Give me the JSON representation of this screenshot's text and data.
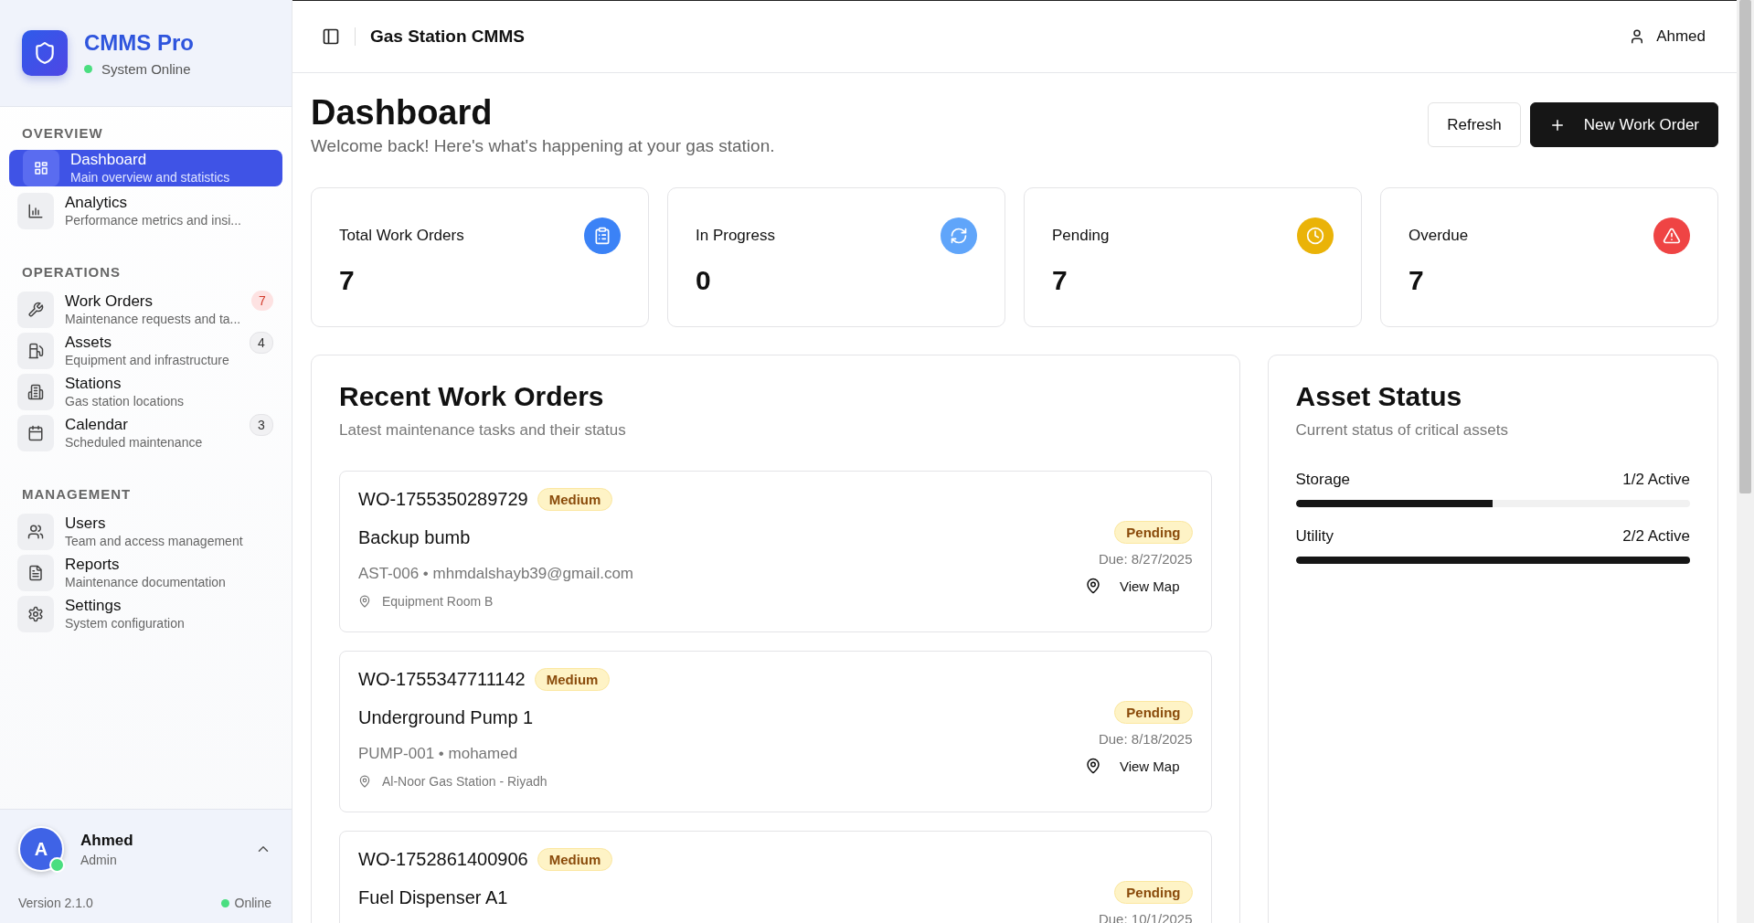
{
  "sidebar": {
    "brand": {
      "name": "CMMS Pro",
      "status": "System Online",
      "online": true
    },
    "sections": [
      {
        "label": "OVERVIEW",
        "items": [
          {
            "kind": "dashboard",
            "title": "Dashboard",
            "subtitle": "Main overview and statistics",
            "selected": true
          },
          {
            "kind": "analytics",
            "title": "Analytics",
            "subtitle": "Performance metrics and insi...",
            "selected": false
          }
        ]
      },
      {
        "label": "OPERATIONS",
        "items": [
          {
            "kind": "work-orders",
            "title": "Work Orders",
            "subtitle": "Maintenance requests and ta...",
            "selected": false,
            "badge": {
              "text": "7",
              "alert": true
            }
          },
          {
            "kind": "assets",
            "title": "Assets",
            "subtitle": "Equipment and infrastructure",
            "selected": false,
            "badge": {
              "text": "4",
              "alert": false
            }
          },
          {
            "kind": "stations",
            "title": "Stations",
            "subtitle": "Gas station locations",
            "selected": false
          },
          {
            "kind": "calendar",
            "title": "Calendar",
            "subtitle": "Scheduled maintenance",
            "selected": false,
            "badge": {
              "text": "3",
              "alert": false
            }
          }
        ]
      },
      {
        "label": "MANAGEMENT",
        "items": [
          {
            "kind": "users",
            "title": "Users",
            "subtitle": "Team and access management",
            "selected": false
          },
          {
            "kind": "reports",
            "title": "Reports",
            "subtitle": "Maintenance documentation",
            "selected": false
          },
          {
            "kind": "settings",
            "title": "Settings",
            "subtitle": "System configuration",
            "selected": false
          }
        ]
      }
    ],
    "user": {
      "initial": "A",
      "name": "Ahmed",
      "role": "Admin",
      "online": true
    },
    "footer": {
      "version": "Version 2.1.0",
      "status": "Online"
    }
  },
  "header": {
    "title": "Gas Station CMMS",
    "user": "Ahmed"
  },
  "page": {
    "title": "Dashboard",
    "subtitle": "Welcome back! Here's what's happening at your gas station.",
    "buttons": [
      {
        "kind": "secondary",
        "label": "Refresh"
      },
      {
        "kind": "primary",
        "label": "New Work Order"
      }
    ]
  },
  "stats": [
    {
      "kind": "total",
      "label": "Total Work Orders",
      "value": "7",
      "color": "#3b82f6"
    },
    {
      "kind": "progress",
      "label": "In Progress",
      "value": "0",
      "color": "#60a5fa"
    },
    {
      "kind": "pending",
      "label": "Pending",
      "value": "7",
      "color": "#eab308"
    },
    {
      "kind": "overdue",
      "label": "Overdue",
      "value": "7",
      "color": "#ef4444"
    }
  ],
  "recent_work_orders": {
    "title": "Recent Work Orders",
    "subtitle": "Latest maintenance tasks and their status",
    "items": [
      {
        "id": "WO-1755350289729",
        "priority": "Medium",
        "title": "Backup bumb",
        "meta": "AST-006 • mhmdalshayb39@gmail.com",
        "location": "Equipment Room B",
        "status": "Pending",
        "due": "Due: 8/27/2025",
        "action": "View Map"
      },
      {
        "id": "WO-1755347711142",
        "priority": "Medium",
        "title": "Underground Pump 1",
        "meta": "PUMP-001 • mohamed",
        "location": "Al-Noor Gas Station - Riyadh",
        "status": "Pending",
        "due": "Due: 8/18/2025",
        "action": "View Map"
      },
      {
        "id": "WO-1752861400906",
        "priority": "Medium",
        "title": "Fuel Dispenser A1",
        "status": "Pending",
        "due": "Due: 10/1/2025"
      }
    ]
  },
  "asset_status": {
    "title": "Asset Status",
    "subtitle": "Current status of critical assets",
    "items": [
      {
        "name": "Storage",
        "reading": "1/2 Active",
        "level": 0.5
      },
      {
        "name": "Utility",
        "reading": "2/2 Active",
        "level": 1
      }
    ]
  }
}
